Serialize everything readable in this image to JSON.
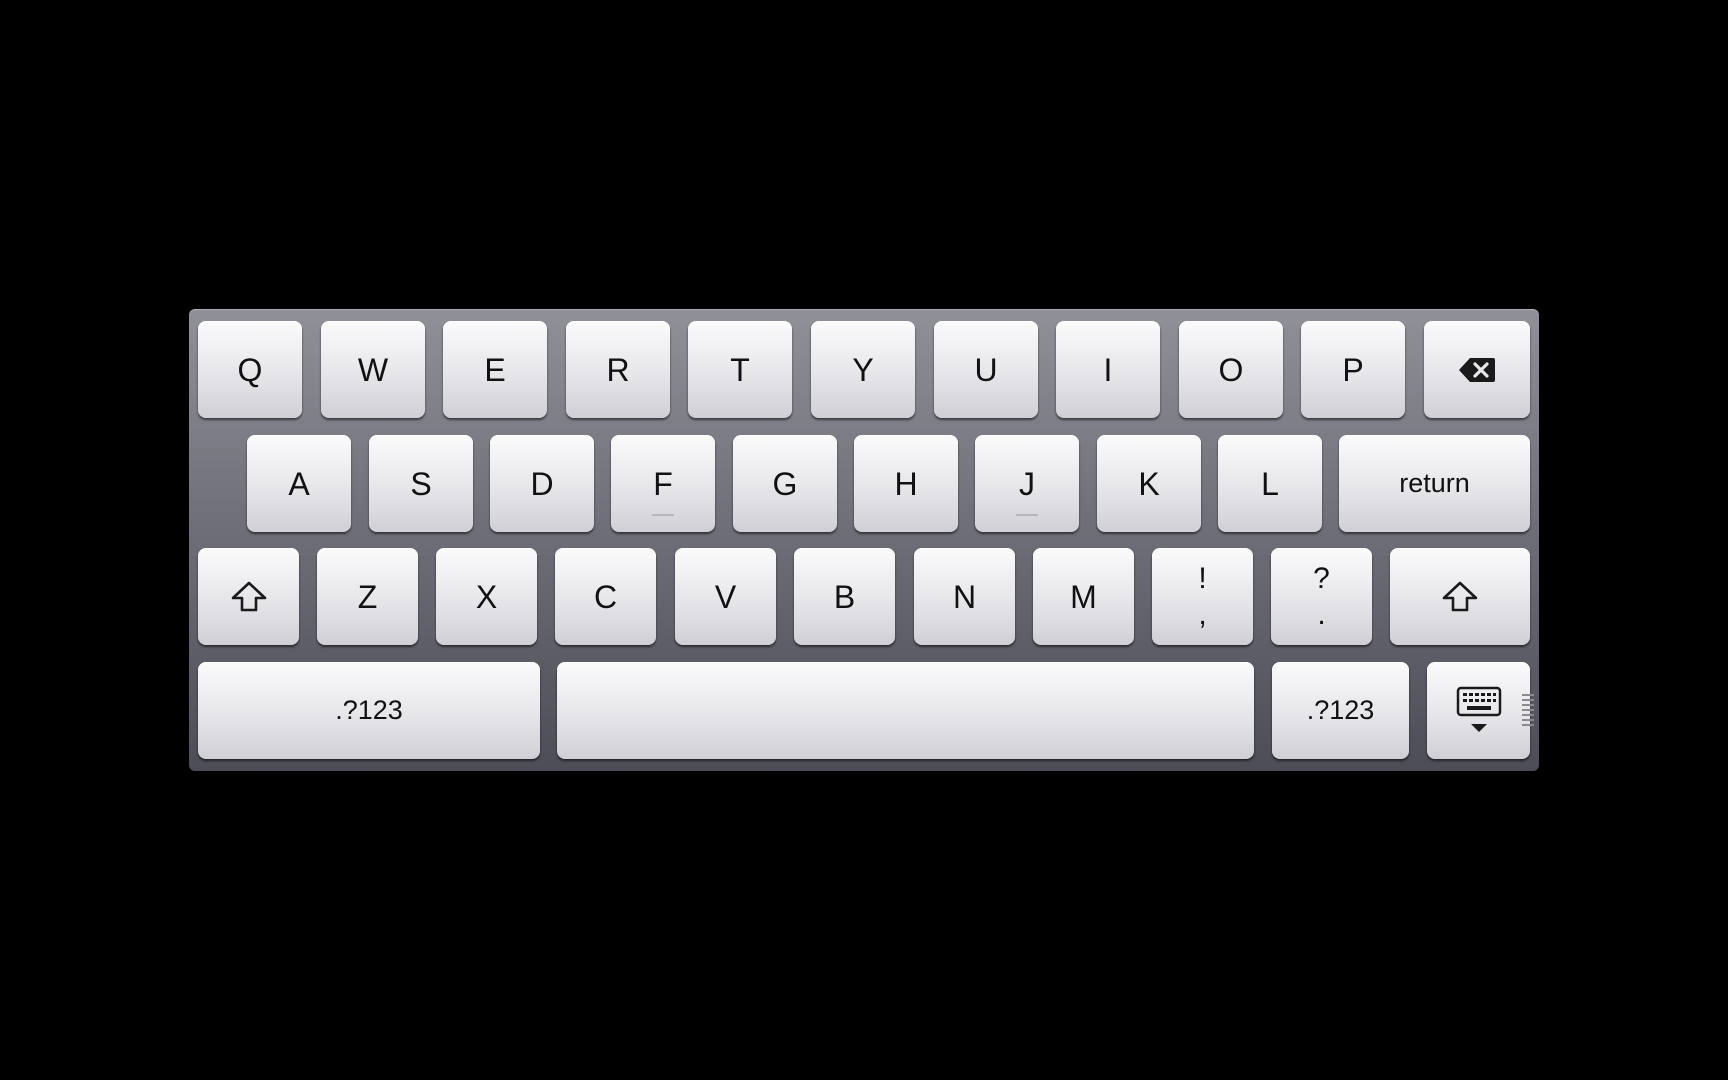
{
  "keyboard": {
    "row1": [
      {
        "label": "Q",
        "name": "key-q"
      },
      {
        "label": "W",
        "name": "key-w"
      },
      {
        "label": "E",
        "name": "key-e"
      },
      {
        "label": "R",
        "name": "key-r"
      },
      {
        "label": "T",
        "name": "key-t"
      },
      {
        "label": "Y",
        "name": "key-y"
      },
      {
        "label": "U",
        "name": "key-u"
      },
      {
        "label": "I",
        "name": "key-i"
      },
      {
        "label": "O",
        "name": "key-o"
      },
      {
        "label": "P",
        "name": "key-p"
      }
    ],
    "delete_icon": "delete-backspace-icon",
    "row2": [
      {
        "label": "A",
        "name": "key-a"
      },
      {
        "label": "S",
        "name": "key-s"
      },
      {
        "label": "D",
        "name": "key-d"
      },
      {
        "label": "F",
        "name": "key-f"
      },
      {
        "label": "G",
        "name": "key-g"
      },
      {
        "label": "H",
        "name": "key-h"
      },
      {
        "label": "J",
        "name": "key-j"
      },
      {
        "label": "K",
        "name": "key-k"
      },
      {
        "label": "L",
        "name": "key-l"
      }
    ],
    "return_label": "return",
    "shift_icon": "shift-arrow-icon",
    "row3": [
      {
        "label": "Z",
        "name": "key-z"
      },
      {
        "label": "X",
        "name": "key-x"
      },
      {
        "label": "C",
        "name": "key-c"
      },
      {
        "label": "V",
        "name": "key-v"
      },
      {
        "label": "B",
        "name": "key-b"
      },
      {
        "label": "N",
        "name": "key-n"
      },
      {
        "label": "M",
        "name": "key-m"
      }
    ],
    "exclam_key": {
      "top": "!",
      "bottom": ","
    },
    "question_key": {
      "top": "?",
      "bottom": "."
    },
    "numbers_left_label": ".?123",
    "numbers_right_label": ".?123",
    "hide_keyboard_icon": "hide-keyboard-icon",
    "colors": {
      "background": "#000000",
      "tray_top": "#8f9098",
      "tray_bottom": "#4c4d56",
      "key_top": "#fbfbfc",
      "key_bottom": "#cfcfd5",
      "glyph": "#111111"
    }
  }
}
